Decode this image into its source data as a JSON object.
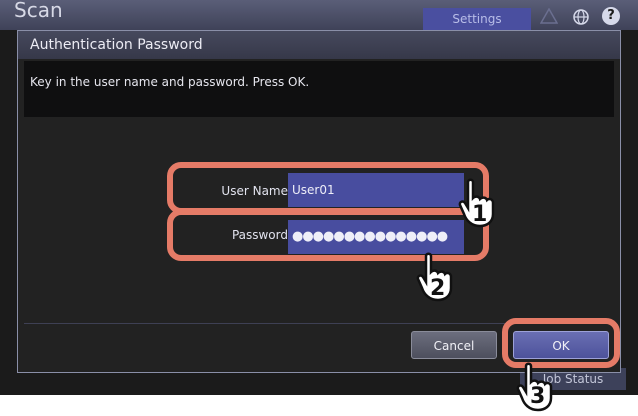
{
  "background": {
    "screen_title": "Scan",
    "settings_tab": "Settings",
    "job_status": "Job Status",
    "help_symbol": "?"
  },
  "dialog": {
    "title": "Authentication Password",
    "message": "Key in the user name and password. Press OK.",
    "username_label": "User Name",
    "username_value": "User01",
    "password_label": "Password",
    "password_value": "●●●●●●●●●●●●●●●",
    "cancel_label": "Cancel",
    "ok_label": "OK"
  },
  "callouts": {
    "step1": "1",
    "step2": "2",
    "step3": "3"
  },
  "colors": {
    "highlight": "#e57b67",
    "field_bg": "#484d9f",
    "ok_button": "#5a5fa8"
  }
}
